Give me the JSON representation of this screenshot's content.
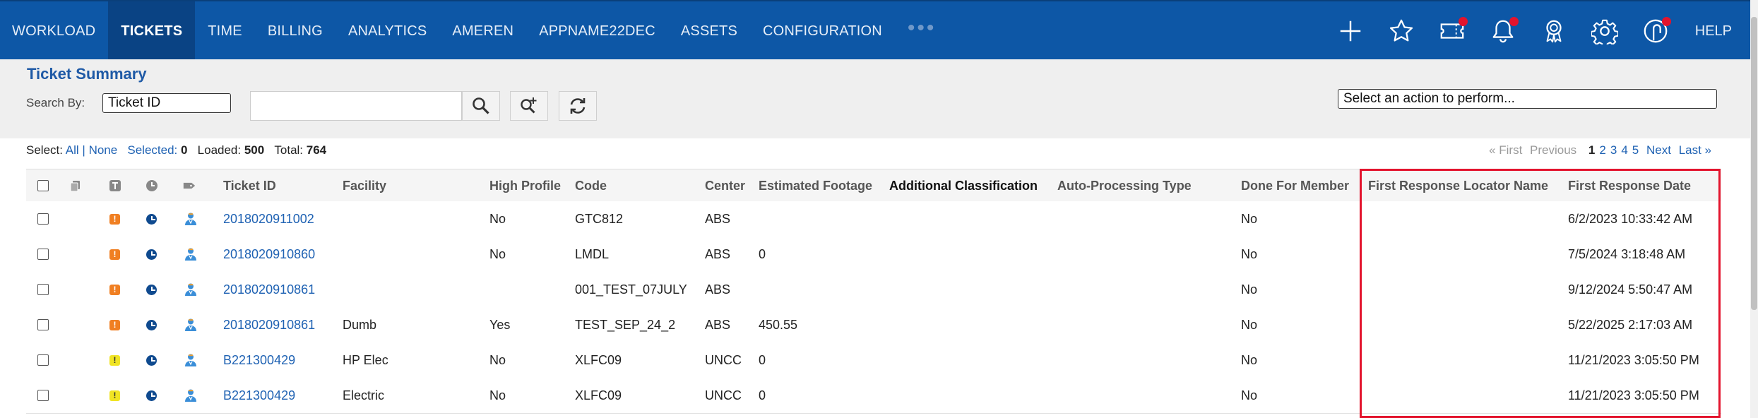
{
  "nav": {
    "items": [
      "WORKLOAD",
      "TICKETS",
      "TIME",
      "BILLING",
      "ANALYTICS",
      "AMEREN",
      "APPNAME22DEC",
      "ASSETS",
      "CONFIGURATION"
    ],
    "active_index": 1,
    "more": "•••",
    "help": "HELP",
    "icons": [
      "plus-icon",
      "star-icon",
      "ticket-icon",
      "bell-icon",
      "award-icon",
      "gear-icon",
      "user-icon"
    ],
    "accent_color": "#0d57a6",
    "notification_color": "#e3142d"
  },
  "summary": {
    "title": "Ticket Summary",
    "search_by_label": "Search By:",
    "search_by_value": "Ticket ID",
    "search_value": "",
    "action_select": "Select an action to perform..."
  },
  "selection": {
    "select_label": "Select:",
    "all": "All",
    "sep": "|",
    "none": "None",
    "selected_label": "Selected:",
    "selected": "0",
    "loaded_label": "Loaded:",
    "loaded": "500",
    "total_label": "Total:",
    "total": "764"
  },
  "pager": {
    "first": "« First",
    "previous": "Previous",
    "pages": [
      "1",
      "2",
      "3",
      "4",
      "5"
    ],
    "current": "1",
    "next": "Next",
    "last": "Last »"
  },
  "table": {
    "columns": [
      "Ticket ID",
      "Facility",
      "High Profile",
      "Code",
      "Center",
      "Estimated Footage",
      "Additional Classification",
      "Auto-Processing Type",
      "Done For Member",
      "First Response Locator Name",
      "First Response Date"
    ],
    "rows": [
      {
        "badge": "orange",
        "ticket_id": "2018020911002",
        "facility": "",
        "high_profile": "No",
        "code": "GTC812",
        "center": "ABS",
        "footage": "",
        "classification": "",
        "auto": "",
        "done": "No",
        "locator": "",
        "date": "6/2/2023 10:33:42 AM"
      },
      {
        "badge": "orange",
        "ticket_id": "2018020910860",
        "facility": "",
        "high_profile": "No",
        "code": "LMDL",
        "center": "ABS",
        "footage": "0",
        "classification": "",
        "auto": "",
        "done": "No",
        "locator": "",
        "date": "7/5/2024 3:18:48 AM"
      },
      {
        "badge": "orange",
        "ticket_id": "2018020910861",
        "facility": "",
        "high_profile": "",
        "code": "001_TEST_07JULY",
        "center": "ABS",
        "footage": "",
        "classification": "",
        "auto": "",
        "done": "No",
        "locator": "",
        "date": "9/12/2024 5:50:47 AM"
      },
      {
        "badge": "orange",
        "ticket_id": "2018020910861",
        "facility": "Dumb",
        "high_profile": "Yes",
        "code": "TEST_SEP_24_2",
        "center": "ABS",
        "footage": "450.55",
        "classification": "",
        "auto": "",
        "done": "No",
        "locator": "",
        "date": "5/22/2025 2:17:03 AM"
      },
      {
        "badge": "yellow",
        "ticket_id": "B221300429",
        "facility": "HP Elec",
        "high_profile": "No",
        "code": "XLFC09",
        "center": "UNCC",
        "footage": "0",
        "classification": "",
        "auto": "",
        "done": "No",
        "locator": "",
        "date": "11/21/2023 3:05:50 PM"
      },
      {
        "badge": "yellow",
        "ticket_id": "B221300429",
        "facility": "Electric",
        "high_profile": "No",
        "code": "XLFC09",
        "center": "UNCC",
        "footage": "0",
        "classification": "",
        "auto": "",
        "done": "No",
        "locator": "",
        "date": "11/21/2023 3:05:50 PM"
      }
    ],
    "badge_glyph": "!",
    "highlight_color": "#e3142d"
  }
}
